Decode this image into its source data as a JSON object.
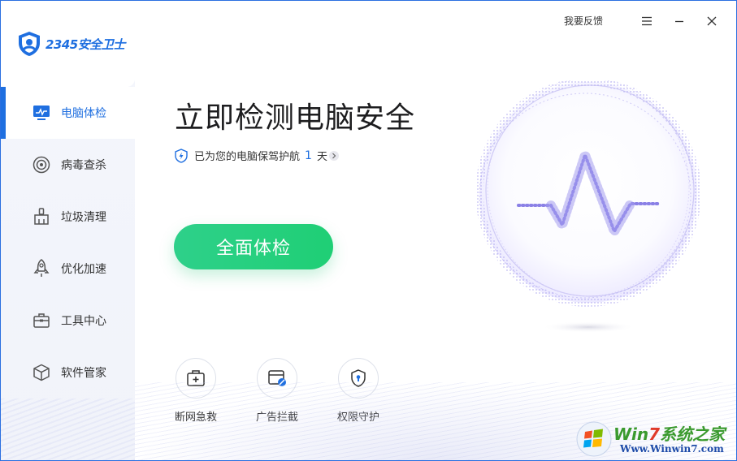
{
  "app": {
    "brand": "2345安全卫士",
    "accent_color": "#1f6fe0",
    "scan_color": "#22cf7a"
  },
  "titlebar": {
    "feedback_label": "我要反馈",
    "menu_icon": "hamburger-icon",
    "minimize_icon": "minimize-icon",
    "close_icon": "close-icon"
  },
  "sidebar": {
    "items": [
      {
        "label": "电脑体检",
        "icon": "monitor-icon",
        "active": true
      },
      {
        "label": "病毒查杀",
        "icon": "target-icon",
        "active": false
      },
      {
        "label": "垃圾清理",
        "icon": "broom-icon",
        "active": false
      },
      {
        "label": "优化加速",
        "icon": "rocket-icon",
        "active": false
      },
      {
        "label": "工具中心",
        "icon": "toolbox-icon",
        "active": false
      },
      {
        "label": "软件管家",
        "icon": "package-icon",
        "active": false
      }
    ]
  },
  "main": {
    "title": "立即检测电脑安全",
    "protect_prefix": "已为您的电脑保驾护航",
    "protect_days": "1",
    "protect_suffix": "天",
    "scan_button": "全面体检"
  },
  "tools": [
    {
      "label": "断网急救",
      "icon": "first-aid-kit-icon"
    },
    {
      "label": "广告拦截",
      "icon": "ad-block-icon"
    },
    {
      "label": "权限守护",
      "icon": "shield-lock-icon"
    }
  ],
  "watermark": {
    "title_a": "Win",
    "title_b": "7",
    "title_c": "系统之家",
    "url": "Www.Winwin7.com"
  }
}
